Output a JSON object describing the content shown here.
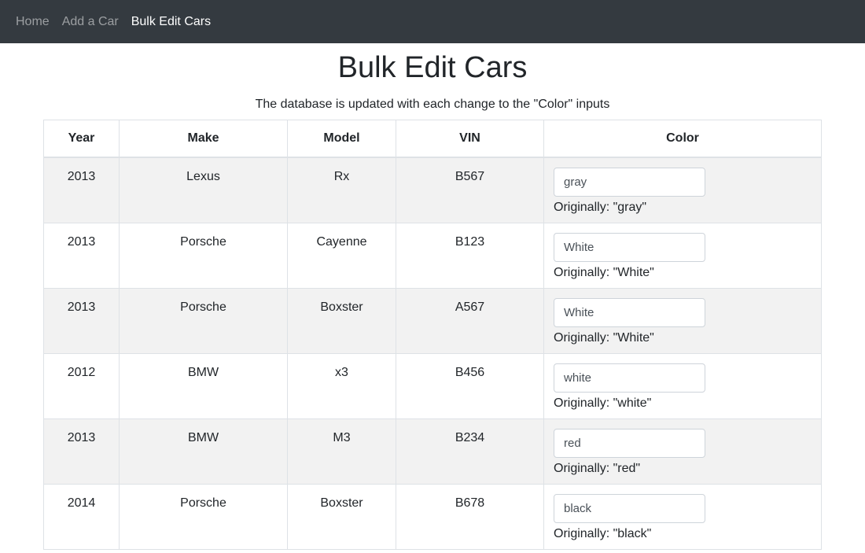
{
  "nav": {
    "items": [
      {
        "label": "Home",
        "active": false
      },
      {
        "label": "Add a Car",
        "active": false
      },
      {
        "label": "Bulk Edit Cars",
        "active": true
      }
    ]
  },
  "page": {
    "title": "Bulk Edit Cars",
    "subtitle": "The database is updated with each change to the \"Color\" inputs"
  },
  "table": {
    "headers": [
      "Year",
      "Make",
      "Model",
      "VIN",
      "Color"
    ],
    "rows": [
      {
        "year": "2013",
        "make": "Lexus",
        "model": "Rx",
        "vin": "B567",
        "color": "gray",
        "original": "Originally: \"gray\""
      },
      {
        "year": "2013",
        "make": "Porsche",
        "model": "Cayenne",
        "vin": "B123",
        "color": "White",
        "original": "Originally: \"White\""
      },
      {
        "year": "2013",
        "make": "Porsche",
        "model": "Boxster",
        "vin": "A567",
        "color": "White",
        "original": "Originally: \"White\""
      },
      {
        "year": "2012",
        "make": "BMW",
        "model": "x3",
        "vin": "B456",
        "color": "white",
        "original": "Originally: \"white\""
      },
      {
        "year": "2013",
        "make": "BMW",
        "model": "M3",
        "vin": "B234",
        "color": "red",
        "original": "Originally: \"red\""
      },
      {
        "year": "2014",
        "make": "Porsche",
        "model": "Boxster",
        "vin": "B678",
        "color": "black",
        "original": "Originally: \"black\""
      }
    ]
  }
}
